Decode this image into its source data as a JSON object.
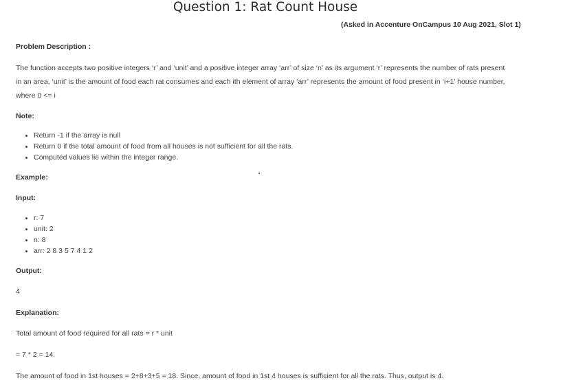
{
  "title": "Question 1: Rat Count House",
  "asked": "(Asked in Accenture OnCampus 10 Aug 2021, Slot 1)",
  "problem_heading": "Problem Description :",
  "description": [
    "The function accepts two positive integers ‘r’ and ‘unit’ and a positive integer array ‘arr’ of size ‘n’ as its argument ‘r’ represents the number of rats present",
    "in an area, ‘unit’ is the amount of food each rat consumes and each ith element of array ‘arr’ represents the amount of food present in ‘i+1’ house number,",
    "where 0 <= i"
  ],
  "note_heading": "Note:",
  "notes": [
    "Return -1 if the array is null",
    "Return 0 if the total amount of food from all houses is not sufficient for all the rats.",
    "Computed values lie within the integer range."
  ],
  "example_heading": "Example:",
  "input_heading": "Input:",
  "inputs": [
    "r: 7",
    "unit: 2",
    "n: 8",
    "arr: 2 8 3 5 7 4 1 2"
  ],
  "output_heading": "Output:",
  "output_value": "4",
  "explanation_heading": "Explanation:",
  "explanation": [
    "Total amount of food required for all rats = r * unit",
    "= 7 * 2 = 14.",
    "The amount of food in 1st houses = 2+8+3+5 = 18. Since, amount of food in 1st 4 houses is sufficient for all the rats. Thus, output is 4."
  ]
}
